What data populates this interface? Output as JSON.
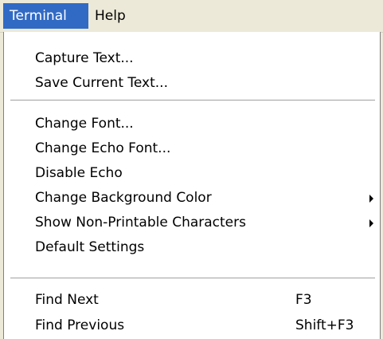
{
  "menubar": {
    "items": [
      {
        "label": "Terminal",
        "active": true
      },
      {
        "label": "Help",
        "active": false
      }
    ]
  },
  "menu": {
    "items": [
      {
        "label": "Capture Text..."
      },
      {
        "label": "Save Current Text..."
      },
      {
        "label": "Change Font..."
      },
      {
        "label": "Change Echo Font..."
      },
      {
        "label": "Disable Echo"
      },
      {
        "label": "Change Background Color",
        "submenu": true
      },
      {
        "label": "Show Non-Printable Characters",
        "submenu": true
      },
      {
        "label": "Default Settings"
      },
      {
        "label": "Find Next",
        "shortcut": "F3"
      },
      {
        "label": "Find Previous",
        "shortcut": "Shift+F3"
      }
    ]
  },
  "colors": {
    "menubar_bg": "#ece9d8",
    "highlight": "#316ac5",
    "menu_bg": "#ffffff"
  },
  "icons": {
    "submenu": "chevron-right-icon"
  }
}
